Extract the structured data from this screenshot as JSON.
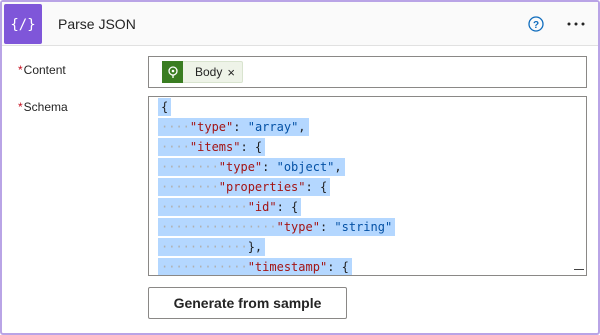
{
  "header": {
    "title": "Parse JSON",
    "icons": [
      "json-action-icon",
      "help-icon",
      "more-icon"
    ],
    "accent_color": "#7f56d9"
  },
  "content": {
    "label": "Content",
    "required_mark": "*",
    "token_label": "Body",
    "token_close": "×",
    "token_color": "#3a7d22"
  },
  "schema": {
    "label": "Schema",
    "required_mark": "*",
    "lines": [
      {
        "indent": "",
        "tokens": [
          {
            "t": "pun",
            "v": "{"
          }
        ]
      },
      {
        "indent": "····",
        "tokens": [
          {
            "t": "key",
            "v": "\"type\""
          },
          {
            "t": "pun",
            "v": ": "
          },
          {
            "t": "str",
            "v": "\"array\""
          },
          {
            "t": "pun",
            "v": ","
          }
        ]
      },
      {
        "indent": "····",
        "tokens": [
          {
            "t": "key",
            "v": "\"items\""
          },
          {
            "t": "pun",
            "v": ": {"
          }
        ]
      },
      {
        "indent": "········",
        "tokens": [
          {
            "t": "key",
            "v": "\"type\""
          },
          {
            "t": "pun",
            "v": ": "
          },
          {
            "t": "str",
            "v": "\"object\""
          },
          {
            "t": "pun",
            "v": ","
          }
        ]
      },
      {
        "indent": "········",
        "tokens": [
          {
            "t": "key",
            "v": "\"properties\""
          },
          {
            "t": "pun",
            "v": ": {"
          }
        ]
      },
      {
        "indent": "············",
        "tokens": [
          {
            "t": "key",
            "v": "\"id\""
          },
          {
            "t": "pun",
            "v": ": {"
          }
        ]
      },
      {
        "indent": "················",
        "tokens": [
          {
            "t": "key",
            "v": "\"type\""
          },
          {
            "t": "pun",
            "v": ": "
          },
          {
            "t": "str",
            "v": "\"string\""
          }
        ]
      },
      {
        "indent": "············",
        "tokens": [
          {
            "t": "pun",
            "v": "},"
          }
        ]
      },
      {
        "indent": "············",
        "tokens": [
          {
            "t": "key",
            "v": "\"timestamp\""
          },
          {
            "t": "pun",
            "v": ": {"
          }
        ]
      }
    ]
  },
  "generate_button": {
    "label": "Generate from sample"
  }
}
